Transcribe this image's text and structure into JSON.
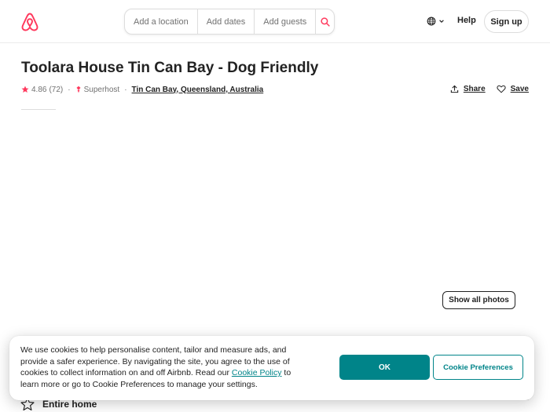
{
  "colors": {
    "brand": "#FF385C",
    "accent": "#008489",
    "text": "#222222",
    "muted": "#717171"
  },
  "header": {
    "logo_icon": "airbnb-logo-icon",
    "search": {
      "location_placeholder": "Add a location",
      "dates_placeholder": "Add dates",
      "guests_placeholder": "Add guests",
      "search_icon": "search-icon"
    },
    "language_icon": "globe-icon",
    "help_label": "Help",
    "signup_label": "Sign up"
  },
  "listing": {
    "title": "Toolara House Tin Can Bay - Dog Friendly",
    "rating": "4.86",
    "reviews": "(72)",
    "superhost_label": "Superhost",
    "location": "Tin Can Bay, Queensland, Australia",
    "share_label": "Share",
    "save_label": "Save",
    "show_photos_label": "Show all photos",
    "type_label": "Entire home"
  },
  "cookie_banner": {
    "text_before_link": "We use cookies to help personalise content, tailor and measure ads, and provide a safer experience. By navigating the site, you agree to the use of cookies to collect information on and off Airbnb. Read our ",
    "policy_link": "Cookie Policy",
    "text_after_link": " to learn more or go to Cookie Preferences to manage your settings.",
    "ok_label": "OK",
    "preferences_label": "Cookie Preferences"
  }
}
